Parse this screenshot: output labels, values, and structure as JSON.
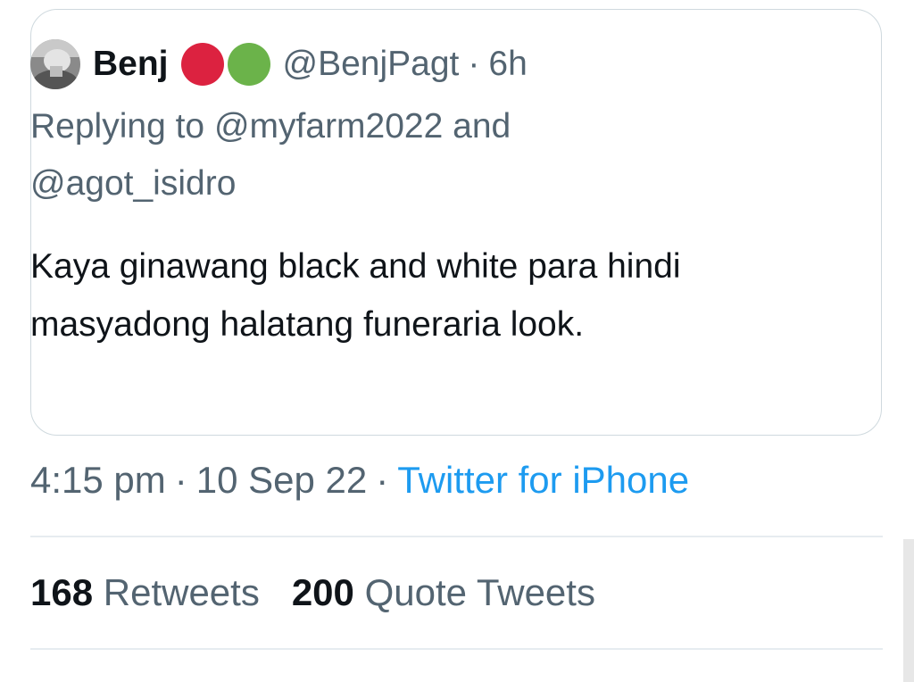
{
  "quoted_tweet": {
    "display_name": "Benj",
    "avatar_icon": "avatar-icon",
    "status_dots": [
      {
        "name": "red-circle-icon",
        "color": "#dc2240"
      },
      {
        "name": "green-circle-icon",
        "color": "#6bb34a"
      }
    ],
    "handle": "@BenjPagt",
    "separator": "·",
    "time_ago": "6h",
    "replying_prefix": "Replying to",
    "reply_mention_1": "@myfarm2022",
    "reply_joiner": "and",
    "reply_mention_2": "@agot_isidro",
    "text": "Kaya ginawang black and white para hindi masyadong halatang funeraria look."
  },
  "meta": {
    "time": "4:15 pm",
    "separator": "·",
    "date": "10 Sep 22",
    "source": "Twitter for iPhone",
    "source_color": "#1d9bf0"
  },
  "stats": {
    "retweets_count": "168",
    "retweets_label": "Retweets",
    "quotes_count": "200",
    "quotes_label": "Quote Tweets"
  }
}
